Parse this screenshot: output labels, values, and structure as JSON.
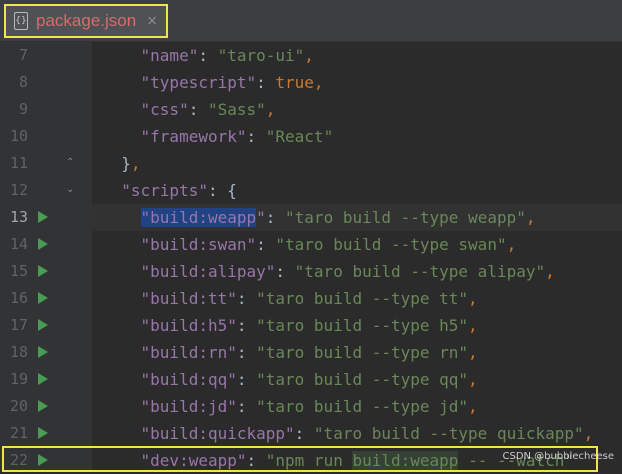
{
  "tab": {
    "title": "package.json",
    "close_glyph": "×",
    "file_icon": "{}"
  },
  "lines": [
    {
      "num": "7",
      "indent": "    ",
      "parts": [
        {
          "t": "\"name\"",
          "c": "key"
        },
        {
          "t": ": ",
          "c": "punct"
        },
        {
          "t": "\"taro-ui\"",
          "c": "str"
        },
        {
          "t": ",",
          "c": "kw"
        }
      ]
    },
    {
      "num": "8",
      "indent": "    ",
      "parts": [
        {
          "t": "\"typescript\"",
          "c": "key"
        },
        {
          "t": ": ",
          "c": "punct"
        },
        {
          "t": "true",
          "c": "kw"
        },
        {
          "t": ",",
          "c": "kw"
        }
      ]
    },
    {
      "num": "9",
      "indent": "    ",
      "parts": [
        {
          "t": "\"css\"",
          "c": "key"
        },
        {
          "t": ": ",
          "c": "punct"
        },
        {
          "t": "\"Sass\"",
          "c": "str"
        },
        {
          "t": ",",
          "c": "kw"
        }
      ]
    },
    {
      "num": "10",
      "indent": "    ",
      "parts": [
        {
          "t": "\"framework\"",
          "c": "key"
        },
        {
          "t": ": ",
          "c": "punct"
        },
        {
          "t": "\"React\"",
          "c": "str"
        }
      ]
    },
    {
      "num": "11",
      "indent": "  ",
      "fold": "close",
      "parts": [
        {
          "t": "}",
          "c": "punct"
        },
        {
          "t": ",",
          "c": "kw"
        }
      ]
    },
    {
      "num": "12",
      "indent": "  ",
      "fold": "open",
      "parts": [
        {
          "t": "\"scripts\"",
          "c": "key"
        },
        {
          "t": ": {",
          "c": "punct"
        }
      ]
    },
    {
      "num": "13",
      "indent": "    ",
      "run": true,
      "current": true,
      "parts": [
        {
          "t": "\"build:weapp",
          "c": "key",
          "sel": true
        },
        {
          "t": "\"",
          "c": "key"
        },
        {
          "t": ": ",
          "c": "punct"
        },
        {
          "t": "\"taro build --type weapp\"",
          "c": "str"
        },
        {
          "t": ",",
          "c": "kw"
        }
      ]
    },
    {
      "num": "14",
      "indent": "    ",
      "run": true,
      "parts": [
        {
          "t": "\"build:swan\"",
          "c": "key"
        },
        {
          "t": ": ",
          "c": "punct"
        },
        {
          "t": "\"taro build --type swan\"",
          "c": "str"
        },
        {
          "t": ",",
          "c": "kw"
        }
      ]
    },
    {
      "num": "15",
      "indent": "    ",
      "run": true,
      "parts": [
        {
          "t": "\"build:alipay\"",
          "c": "key"
        },
        {
          "t": ": ",
          "c": "punct"
        },
        {
          "t": "\"taro build --type alipay\"",
          "c": "str"
        },
        {
          "t": ",",
          "c": "kw"
        }
      ]
    },
    {
      "num": "16",
      "indent": "    ",
      "run": true,
      "parts": [
        {
          "t": "\"build:tt\"",
          "c": "key"
        },
        {
          "t": ": ",
          "c": "punct"
        },
        {
          "t": "\"taro build --type tt\"",
          "c": "str"
        },
        {
          "t": ",",
          "c": "kw"
        }
      ]
    },
    {
      "num": "17",
      "indent": "    ",
      "run": true,
      "parts": [
        {
          "t": "\"build:h5\"",
          "c": "key"
        },
        {
          "t": ": ",
          "c": "punct"
        },
        {
          "t": "\"taro build --type h5\"",
          "c": "str"
        },
        {
          "t": ",",
          "c": "kw"
        }
      ]
    },
    {
      "num": "18",
      "indent": "    ",
      "run": true,
      "parts": [
        {
          "t": "\"build:rn\"",
          "c": "key"
        },
        {
          "t": ": ",
          "c": "punct"
        },
        {
          "t": "\"taro build --type rn\"",
          "c": "str"
        },
        {
          "t": ",",
          "c": "kw"
        }
      ]
    },
    {
      "num": "19",
      "indent": "    ",
      "run": true,
      "parts": [
        {
          "t": "\"build:qq\"",
          "c": "key"
        },
        {
          "t": ": ",
          "c": "punct"
        },
        {
          "t": "\"taro build --type qq\"",
          "c": "str"
        },
        {
          "t": ",",
          "c": "kw"
        }
      ]
    },
    {
      "num": "20",
      "indent": "    ",
      "run": true,
      "parts": [
        {
          "t": "\"build:jd\"",
          "c": "key"
        },
        {
          "t": ": ",
          "c": "punct"
        },
        {
          "t": "\"taro build --type jd\"",
          "c": "str"
        },
        {
          "t": ",",
          "c": "kw"
        }
      ]
    },
    {
      "num": "21",
      "indent": "    ",
      "run": true,
      "parts": [
        {
          "t": "\"build:quickapp\"",
          "c": "key"
        },
        {
          "t": ": ",
          "c": "punct"
        },
        {
          "t": "\"taro build --type quickapp\"",
          "c": "str"
        },
        {
          "t": ",",
          "c": "kw"
        }
      ]
    },
    {
      "num": "22",
      "indent": "    ",
      "run": true,
      "parts": [
        {
          "t": "\"dev:weapp\"",
          "c": "key"
        },
        {
          "t": ": ",
          "c": "punct"
        },
        {
          "t": "\"npm run ",
          "c": "str"
        },
        {
          "t": "build:weapp",
          "c": "str",
          "usage": true
        },
        {
          "t": " -- --watch\"",
          "c": "str"
        }
      ]
    }
  ],
  "watermark": "CSDN @bubblecheese",
  "colors": {
    "background": "#2b2b2b",
    "gutter": "#313335",
    "key": "#9876aa",
    "string": "#6a8759",
    "keyword": "#cc7832",
    "highlight_box": "#f0e64a",
    "tab_title": "#d86a6a",
    "run_icon": "#499c54",
    "selection": "#214283"
  }
}
